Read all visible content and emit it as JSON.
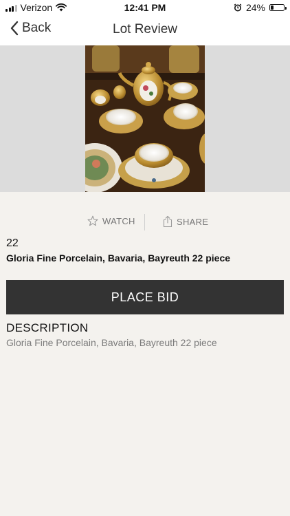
{
  "status_bar": {
    "carrier": "Verizon",
    "time": "12:41 PM",
    "battery_percent": "24%",
    "battery_level": 0.24,
    "icons": [
      "signal-icon",
      "wifi-icon",
      "alarm-icon",
      "battery-icon"
    ]
  },
  "nav": {
    "back_label": "Back",
    "title": "Lot Review"
  },
  "actions": {
    "watch_label": "WATCH",
    "share_label": "SHARE"
  },
  "lot": {
    "number": "22",
    "title": "Gloria Fine Porcelain, Bavaria, Bayreuth 22 piece"
  },
  "bid_button_label": "PLACE BID",
  "description": {
    "heading": "DESCRIPTION",
    "text": "Gloria Fine Porcelain, Bavaria, Bayreuth 22 piece"
  },
  "colors": {
    "accent_button": "#333333",
    "background": "#f4f2ee",
    "muted_text": "#777777"
  }
}
